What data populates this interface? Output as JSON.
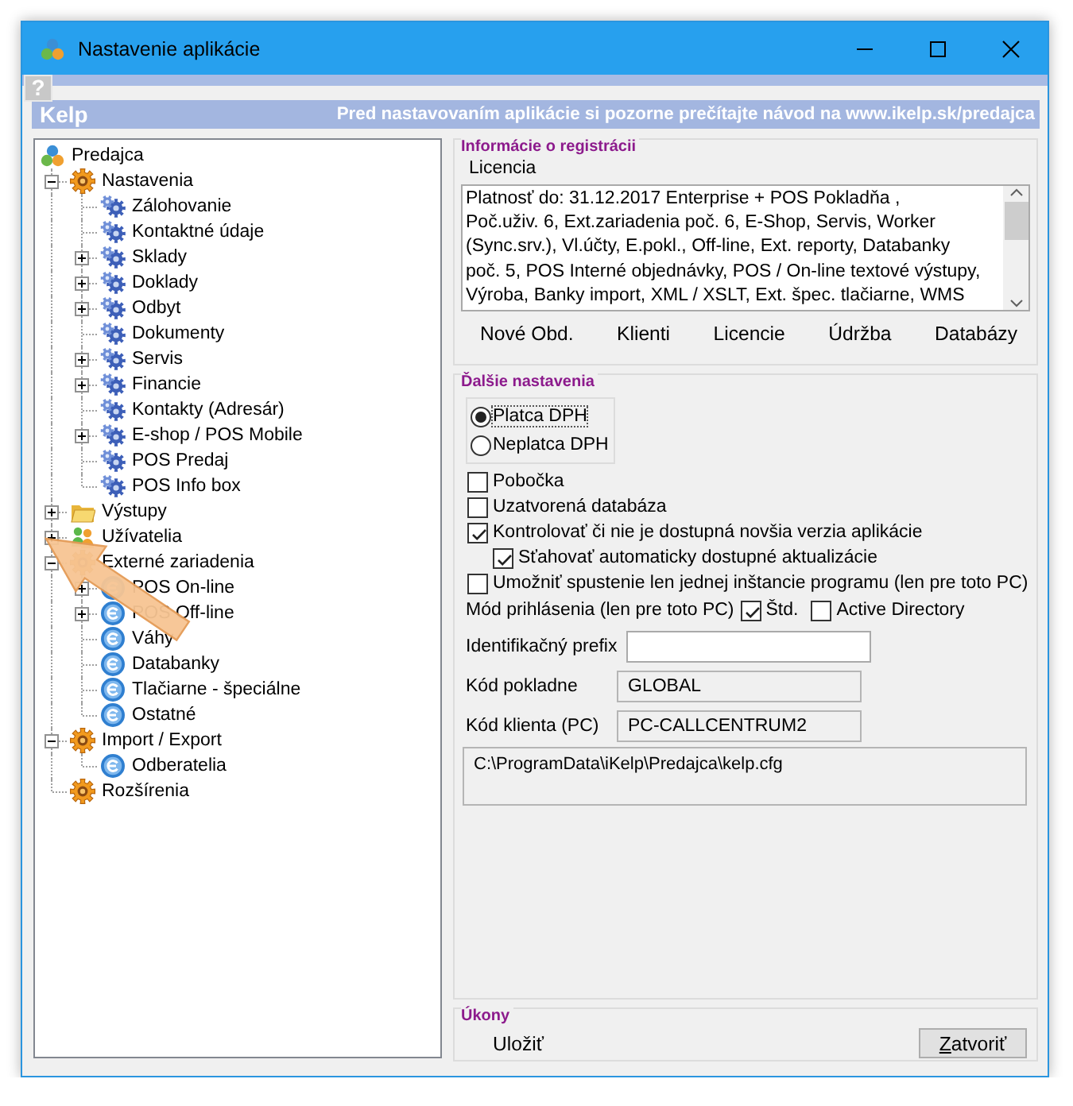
{
  "window": {
    "title": "Nastavenie aplikácie",
    "help_button": "?"
  },
  "header": {
    "app_name": "Kelp",
    "notice": "Pred nastavovaním aplikácie si pozorne prečítajte návod na www.ikelp.sk/predajca"
  },
  "tree": [
    {
      "label": "Predajca",
      "kind": "app",
      "children": [
        {
          "label": "Nastavenia",
          "kind": "group",
          "expanded": true,
          "children": [
            {
              "label": "Zálohovanie",
              "kind": "setting"
            },
            {
              "label": "Kontaktné údaje",
              "kind": "setting"
            },
            {
              "label": "Sklady",
              "kind": "setting",
              "expanded": false
            },
            {
              "label": "Doklady",
              "kind": "setting",
              "expanded": false
            },
            {
              "label": "Odbyt",
              "kind": "setting",
              "expanded": false
            },
            {
              "label": "Dokumenty",
              "kind": "setting"
            },
            {
              "label": "Servis",
              "kind": "setting",
              "expanded": false
            },
            {
              "label": "Financie",
              "kind": "setting",
              "expanded": false
            },
            {
              "label": "Kontakty (Adresár)",
              "kind": "setting"
            },
            {
              "label": "E-shop / POS Mobile",
              "kind": "setting",
              "expanded": false
            },
            {
              "label": "POS Predaj",
              "kind": "setting"
            },
            {
              "label": "POS Info box",
              "kind": "setting"
            }
          ]
        },
        {
          "label": "Výstupy",
          "kind": "folder",
          "expanded": false
        },
        {
          "label": "Užívatelia",
          "kind": "users",
          "expanded": false
        },
        {
          "label": "Externé zariadenia",
          "kind": "group",
          "expanded": true,
          "children": [
            {
              "label": "POS On-line",
              "kind": "device",
              "expanded": false
            },
            {
              "label": "POS Off-line",
              "kind": "device",
              "expanded": false
            },
            {
              "label": "Váhy",
              "kind": "device"
            },
            {
              "label": "Databanky",
              "kind": "device"
            },
            {
              "label": "Tlačiarne - špeciálne",
              "kind": "device"
            },
            {
              "label": "Ostatné",
              "kind": "device"
            }
          ]
        },
        {
          "label": "Import / Export",
          "kind": "group",
          "expanded": true,
          "children": [
            {
              "label": "Odberatelia",
              "kind": "device"
            }
          ]
        },
        {
          "label": "Rozšírenia",
          "kind": "group"
        }
      ]
    }
  ],
  "registration": {
    "title": "Informácie o registrácii",
    "license_label": "Licencia",
    "license_lines": [
      "Platnosť do: 31.12.2017 Enterprise + POS Pokladňa ,",
      "Poč.uživ. 6, Ext.zariadenia poč. 6, E-Shop, Servis, Worker",
      "(Sync.srv.), Vl.účty, E.pokl., Off-line, Ext. reporty, Databanky",
      "poč. 5, POS Interné objednávky, POS / On-line textové výstupy,",
      "Výroba, Banky import, XML / XSLT, Ext. špec. tlačiarne, WMS"
    ],
    "buttons": [
      "Nové Obd.",
      "Klienti",
      "Licencie",
      "Údržba",
      "Databázy"
    ]
  },
  "settings": {
    "title": "Ďalšie nastavenia",
    "vat": [
      {
        "label": "Platca DPH",
        "selected": true
      },
      {
        "label": "Neplatca DPH",
        "selected": false
      }
    ],
    "options": [
      {
        "label": "Pobočka",
        "checked": false
      },
      {
        "label": "Uzatvorená databáza",
        "checked": false
      },
      {
        "label": "Kontrolovať či nie je dostupná novšia verzia aplikácie",
        "checked": true,
        "children": [
          {
            "label": "Sťahovať automaticky dostupné aktualizácie",
            "checked": true
          }
        ]
      },
      {
        "label": "Umožniť spustenie len jednej inštancie programu (len pre toto PC)",
        "checked": false
      }
    ],
    "login_mode": {
      "label": "Mód prihlásenia (len pre toto PC)",
      "options": [
        {
          "label": "Štd.",
          "checked": true
        },
        {
          "label": "Active Directory",
          "checked": false
        }
      ]
    },
    "fields": [
      {
        "label": "Identifikačný prefix",
        "readonly": false
      },
      {
        "label": "Kód pokladne",
        "value": "GLOBAL",
        "readonly": true
      },
      {
        "label": "Kód klienta (PC)",
        "value": "PC-CALLCENTRUM2",
        "readonly": true
      }
    ],
    "config_path": "C:\\ProgramData\\iKelp\\Predajca\\kelp.cfg"
  },
  "actions": {
    "title": "Úkony",
    "buttons": [
      {
        "label": "Uložiť",
        "kind": "flat"
      },
      {
        "label": "Zatvoriť",
        "kind": "raised"
      }
    ]
  }
}
